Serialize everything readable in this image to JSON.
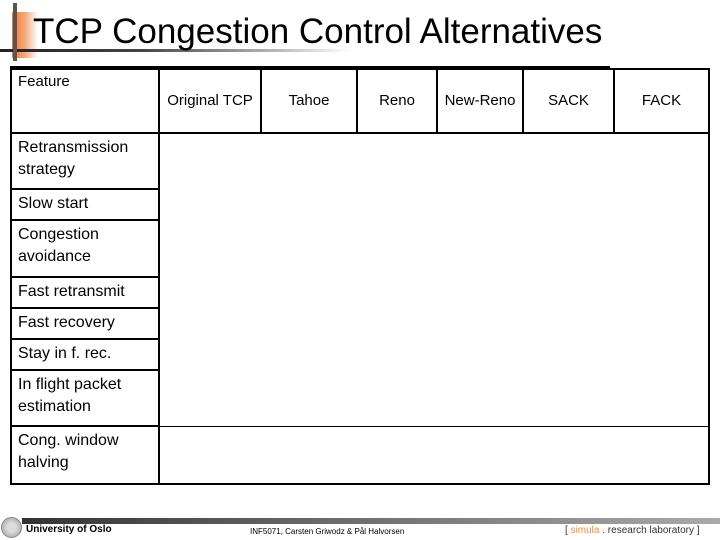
{
  "slide": {
    "title": "TCP Congestion Control Alternatives"
  },
  "table": {
    "corner_label": "Feature",
    "columns": [
      "Original TCP",
      "Tahoe",
      "Reno",
      "New-Reno",
      "SACK",
      "FACK"
    ],
    "rows": [
      {
        "feature": "Retransmission strategy",
        "line1": "Retransmission",
        "line2": "strategy"
      },
      {
        "feature": "Slow start",
        "line1": "Slow start",
        "line2": ""
      },
      {
        "feature": "Congestion avoidance",
        "line1": "Congestion",
        "line2": "avoidance"
      },
      {
        "feature": "Fast retransmit",
        "line1": "Fast retransmit",
        "line2": ""
      },
      {
        "feature": "Fast recovery",
        "line1": "Fast recovery",
        "line2": ""
      },
      {
        "feature": "Stay in f. rec.",
        "line1": "Stay in f. rec.",
        "line2": ""
      },
      {
        "feature": "In flight packet estimation",
        "line1": "In flight packet",
        "line2": "estimation"
      },
      {
        "feature": "Cong. window halving",
        "line1": "Cong. window",
        "line2": "halving"
      }
    ]
  },
  "footer": {
    "university": "University of Oslo",
    "credit": "INF5071, Carsten Griwodz & Pål Halvorsen",
    "lab_open": "[ ",
    "lab_brand": "simula",
    "lab_rest": " . research laboratory ]"
  }
}
